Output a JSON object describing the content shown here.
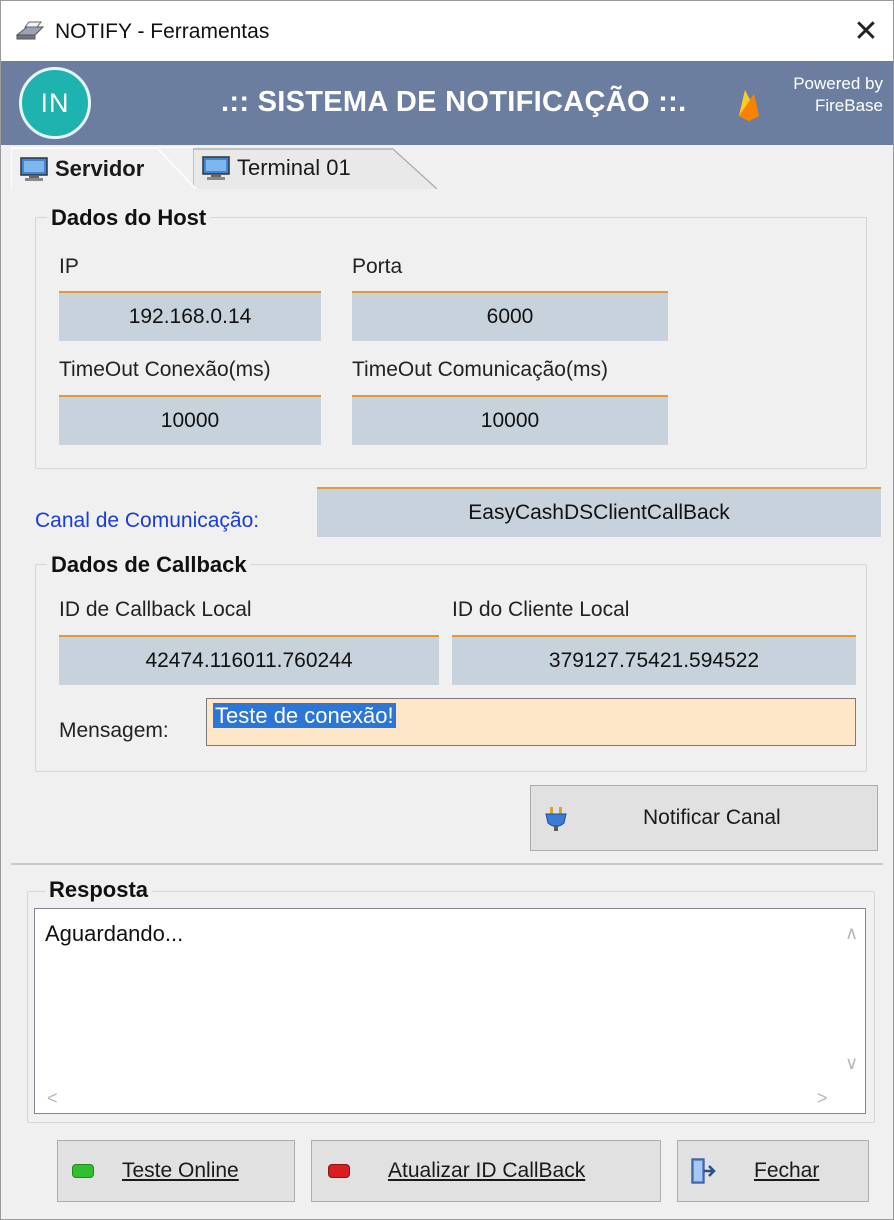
{
  "window": {
    "title": "NOTIFY - Ferramentas",
    "close_label": "✕"
  },
  "banner": {
    "logo_text": "IN",
    "title": ".:: SISTEMA DE NOTIFICAÇÃO ::.",
    "powered_line1": "Powered by",
    "powered_line2": "FireBase"
  },
  "tabs": [
    {
      "label": "Servidor",
      "active": true
    },
    {
      "label": "Terminal 01",
      "active": false
    }
  ],
  "host": {
    "group_title": "Dados do Host",
    "ip_label": "IP",
    "ip_value": "192.168.0.14",
    "port_label": "Porta",
    "port_value": "6000",
    "timeout_conn_label": "TimeOut Conexão(ms)",
    "timeout_conn_value": "10000",
    "timeout_comm_label": "TimeOut Comunicação(ms)",
    "timeout_comm_value": "10000"
  },
  "channel": {
    "label": "Canal de Comunicação:",
    "value": "EasyCashDSClientCallBack"
  },
  "callback": {
    "group_title": "Dados de Callback",
    "local_id_label": "ID de Callback Local",
    "local_id_value": "42474.116011.760244",
    "client_id_label": "ID do Cliente Local",
    "client_id_value": "379127.75421.594522",
    "message_label": "Mensagem:",
    "message_value": "Teste de conexão!"
  },
  "notify_button": {
    "label": "Notificar Canal",
    "icon": "plug-icon"
  },
  "response": {
    "group_title": "Resposta",
    "text": "Aguardando..."
  },
  "footer": {
    "test_online_label": "Teste Online",
    "test_online_led_color": "#2fbf2f",
    "refresh_label": "Atualizar ID CallBack",
    "refresh_led_color": "#d81e1e",
    "close_label": "Fechar",
    "close_icon": "exit-door-icon"
  },
  "colors": {
    "banner_bg": "#6c7ea0",
    "field_bg": "#c8d2dc",
    "field_accent": "#e8963a",
    "message_bg": "#fde7c8",
    "link_blue": "#1a3cd8",
    "logo_teal": "#1fb3b0"
  }
}
